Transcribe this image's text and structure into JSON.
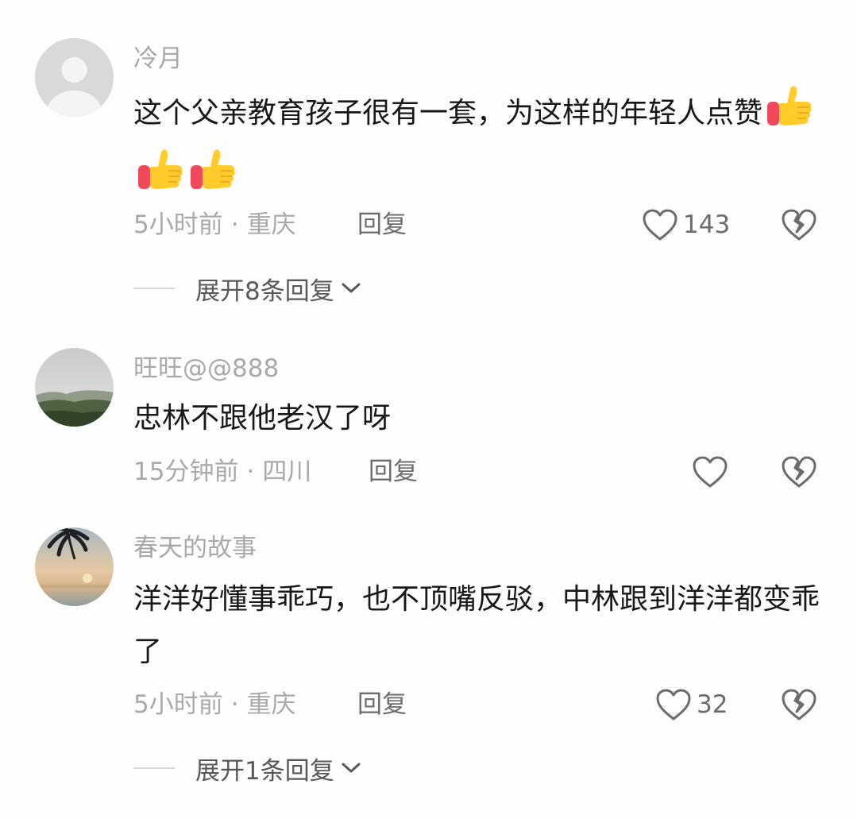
{
  "comments": [
    {
      "username": "冷月",
      "text": "这个父亲教育孩子很有一套，为这样的年轻人点赞",
      "emojis": [
        "thumbs-up",
        "thumbs-up",
        "thumbs-up"
      ],
      "time": "5小时前",
      "separator": "·",
      "location": "重庆",
      "reply_label": "回复",
      "likes": "143",
      "expand_label": "展开8条回复"
    },
    {
      "username": "旺旺@@888",
      "text": "忠林不跟他老汉了呀",
      "time": "15分钟前",
      "separator": "·",
      "location": "四川",
      "reply_label": "回复",
      "likes": ""
    },
    {
      "username": "春天的故事",
      "text": "洋洋好懂事乖巧，也不顶嘴反驳，中林跟到洋洋都变乖了",
      "time": "5小时前",
      "separator": "·",
      "location": "重庆",
      "reply_label": "回复",
      "likes": "32",
      "expand_label": "展开1条回复"
    }
  ],
  "colors": {
    "meta": "#a9a9ad",
    "text": "#18181c",
    "icon": "#6c6c70"
  }
}
